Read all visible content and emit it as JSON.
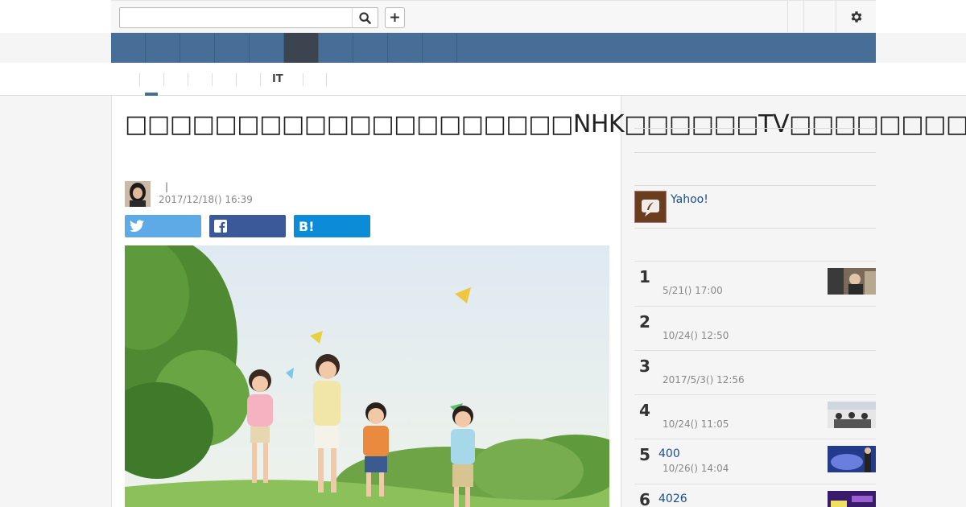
{
  "header": {
    "search": {
      "value": "",
      "placeholder": ""
    },
    "add_label": "+"
  },
  "colors": {
    "nav_bg": "#476e96",
    "nav_active": "#3c4450",
    "link": "#1a4d8f",
    "share_twitter": "#5eaae6",
    "share_facebook": "#3b5998",
    "share_hatena": "#0c8bd6"
  },
  "subnav": {
    "items": [
      {
        "label": ""
      },
      {
        "label": ""
      },
      {
        "label": ""
      },
      {
        "label": ""
      },
      {
        "label": ""
      },
      {
        "label": "IT"
      },
      {
        "label": ""
      }
    ]
  },
  "article": {
    "title": "□□□□□□□□□□□□□□□□□□□□NHK□□□□□□TV□□□□□□□□□□",
    "author_separator": "|",
    "date": "2017/12/18() 16:39",
    "share": {
      "twitter_icon": "twitter-bird-icon",
      "facebook_icon": "facebook-f-icon",
      "hatena_label": "B!"
    }
  },
  "sidebar": {
    "pr_text": "Yahoo!",
    "ranking": [
      {
        "rank": "1",
        "title": "",
        "date": "5/21() 17:00",
        "has_thumb": true
      },
      {
        "rank": "2",
        "title": "",
        "date": "10/24() 12:50",
        "has_thumb": false
      },
      {
        "rank": "3",
        "title": "",
        "date": "2017/5/3() 12:56",
        "has_thumb": false
      },
      {
        "rank": "4",
        "title": "",
        "date": "10/24() 11:05",
        "has_thumb": true
      },
      {
        "rank": "5",
        "title": "400",
        "date": "10/26() 14:04",
        "has_thumb": true
      },
      {
        "rank": "6",
        "title": "4026",
        "date": "",
        "has_thumb": true
      }
    ]
  }
}
